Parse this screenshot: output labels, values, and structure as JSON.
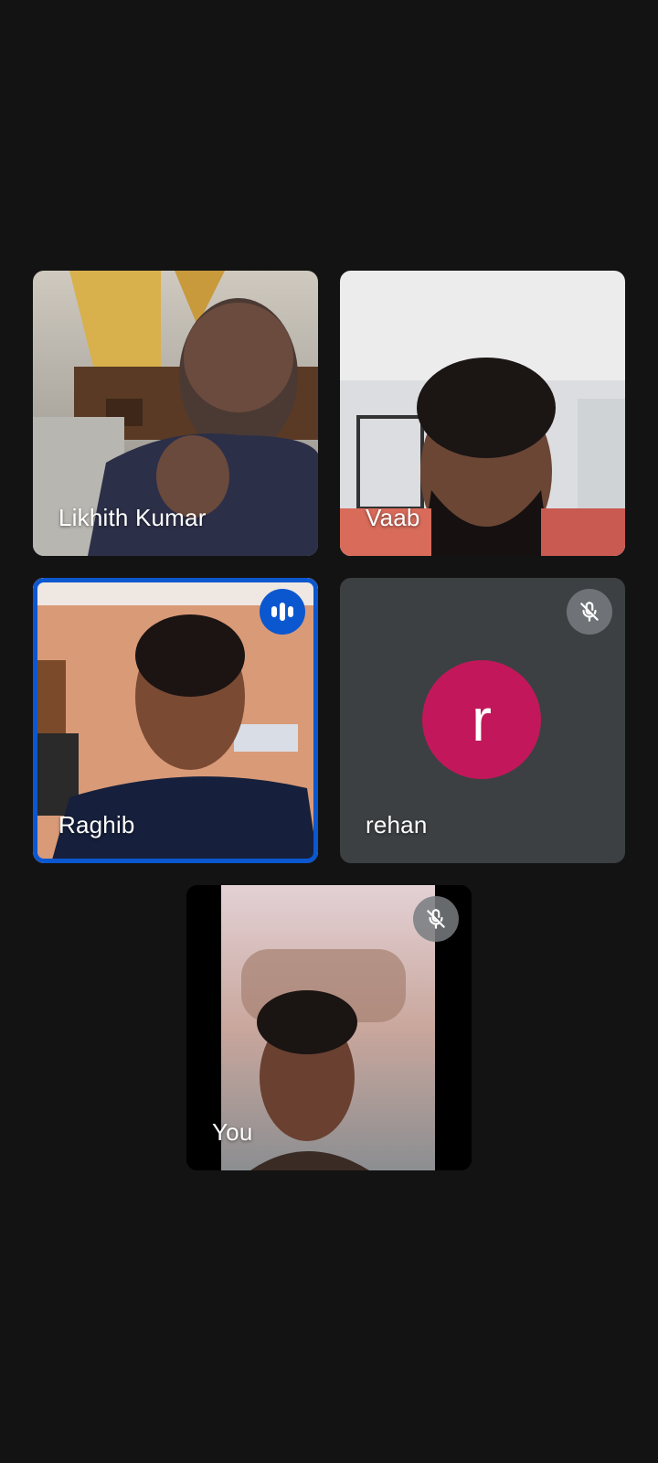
{
  "participants": [
    {
      "name": "Likhith Kumar",
      "muted": false,
      "speaking": false
    },
    {
      "name": "Vaab",
      "muted": false,
      "speaking": false
    },
    {
      "name": "Raghib",
      "muted": false,
      "speaking": true
    },
    {
      "name": "rehan",
      "muted": true,
      "speaking": false,
      "avatar_letter": "r",
      "avatar_color": "#c2185b"
    },
    {
      "name": "You",
      "muted": true,
      "speaking": false
    }
  ],
  "icons": {
    "muted": "mic-off-icon",
    "speaking": "audio-level-icon"
  },
  "colors": {
    "background": "#131313",
    "tile": "#3c4043",
    "speaking_accent": "#0b57d0"
  }
}
